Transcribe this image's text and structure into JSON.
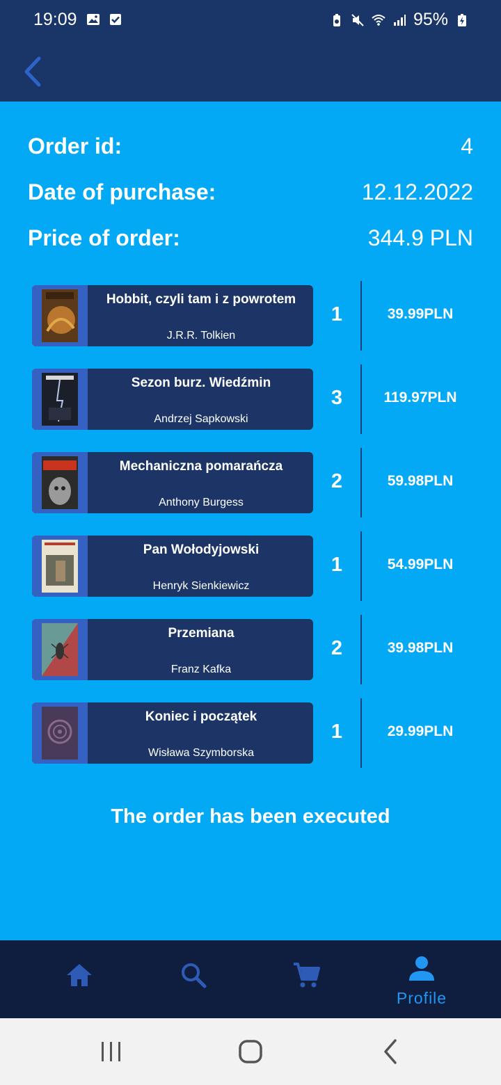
{
  "status_bar": {
    "time": "19:09",
    "battery": "95%",
    "icons": [
      "image-icon",
      "check-box-icon",
      "battery-saver-icon",
      "mute-icon",
      "wifi-icon",
      "signal-icon",
      "battery-charging-icon"
    ]
  },
  "app_bar": {
    "back_icon": "chevron-left-icon"
  },
  "order": {
    "id_label": "Order id:",
    "id_value": "4",
    "date_label": "Date of purchase:",
    "date_value": "12.12.2022",
    "price_label": "Price of order:",
    "price_value": "344.9 PLN"
  },
  "items": [
    {
      "title": "Hobbit, czyli tam i z powrotem",
      "author": "J.R.R. Tolkien",
      "quantity": "1",
      "price": "39.99PLN",
      "cover_color": "#5a3a1a"
    },
    {
      "title": "Sezon burz. Wiedźmin",
      "author": "Andrzej Sapkowski",
      "quantity": "3",
      "price": "119.97PLN",
      "cover_color": "#1a1f2a"
    },
    {
      "title": "Mechaniczna pomarańcza",
      "author": "Anthony Burgess",
      "quantity": "2",
      "price": "59.98PLN",
      "cover_color": "#2b2b2b"
    },
    {
      "title": "Pan Wołodyjowski",
      "author": "Henryk Sienkiewicz",
      "quantity": "1",
      "price": "54.99PLN",
      "cover_color": "#e9e2cf"
    },
    {
      "title": "Przemiana",
      "author": "Franz Kafka",
      "quantity": "2",
      "price": "39.98PLN",
      "cover_color": "#6a9a96"
    },
    {
      "title": "Koniec i początek",
      "author": "Wisława Szymborska",
      "quantity": "1",
      "price": "29.99PLN",
      "cover_color": "#4a3a5a"
    }
  ],
  "status_message": "The order has been executed",
  "bottom_nav": {
    "items": [
      {
        "icon": "home-icon",
        "label": ""
      },
      {
        "icon": "search-icon",
        "label": ""
      },
      {
        "icon": "cart-icon",
        "label": ""
      },
      {
        "icon": "person-icon",
        "label": "Profile"
      }
    ],
    "active": "Profile"
  },
  "colors": {
    "background": "#03a9f4",
    "header": "#1a3568",
    "card": "#1c3566",
    "nav_background": "#0f1e3f",
    "accent": "#2196f3",
    "icon_blue": "#3461c2"
  }
}
